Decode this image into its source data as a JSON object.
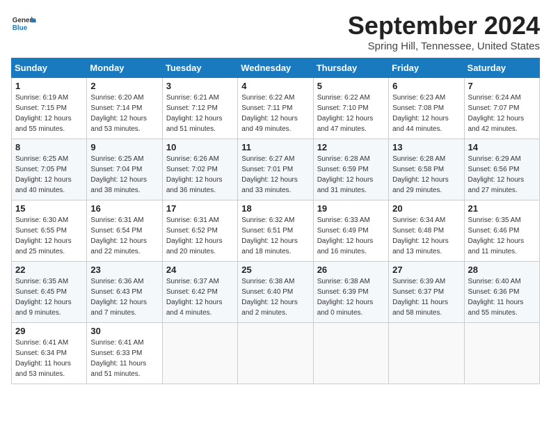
{
  "header": {
    "logo_general": "General",
    "logo_blue": "Blue",
    "title": "September 2024",
    "subtitle": "Spring Hill, Tennessee, United States"
  },
  "weekdays": [
    "Sunday",
    "Monday",
    "Tuesday",
    "Wednesday",
    "Thursday",
    "Friday",
    "Saturday"
  ],
  "weeks": [
    [
      {
        "day": "1",
        "sunrise": "6:19 AM",
        "sunset": "7:15 PM",
        "daylight": "12 hours and 55 minutes."
      },
      {
        "day": "2",
        "sunrise": "6:20 AM",
        "sunset": "7:14 PM",
        "daylight": "12 hours and 53 minutes."
      },
      {
        "day": "3",
        "sunrise": "6:21 AM",
        "sunset": "7:12 PM",
        "daylight": "12 hours and 51 minutes."
      },
      {
        "day": "4",
        "sunrise": "6:22 AM",
        "sunset": "7:11 PM",
        "daylight": "12 hours and 49 minutes."
      },
      {
        "day": "5",
        "sunrise": "6:22 AM",
        "sunset": "7:10 PM",
        "daylight": "12 hours and 47 minutes."
      },
      {
        "day": "6",
        "sunrise": "6:23 AM",
        "sunset": "7:08 PM",
        "daylight": "12 hours and 44 minutes."
      },
      {
        "day": "7",
        "sunrise": "6:24 AM",
        "sunset": "7:07 PM",
        "daylight": "12 hours and 42 minutes."
      }
    ],
    [
      {
        "day": "8",
        "sunrise": "6:25 AM",
        "sunset": "7:05 PM",
        "daylight": "12 hours and 40 minutes."
      },
      {
        "day": "9",
        "sunrise": "6:25 AM",
        "sunset": "7:04 PM",
        "daylight": "12 hours and 38 minutes."
      },
      {
        "day": "10",
        "sunrise": "6:26 AM",
        "sunset": "7:02 PM",
        "daylight": "12 hours and 36 minutes."
      },
      {
        "day": "11",
        "sunrise": "6:27 AM",
        "sunset": "7:01 PM",
        "daylight": "12 hours and 33 minutes."
      },
      {
        "day": "12",
        "sunrise": "6:28 AM",
        "sunset": "6:59 PM",
        "daylight": "12 hours and 31 minutes."
      },
      {
        "day": "13",
        "sunrise": "6:28 AM",
        "sunset": "6:58 PM",
        "daylight": "12 hours and 29 minutes."
      },
      {
        "day": "14",
        "sunrise": "6:29 AM",
        "sunset": "6:56 PM",
        "daylight": "12 hours and 27 minutes."
      }
    ],
    [
      {
        "day": "15",
        "sunrise": "6:30 AM",
        "sunset": "6:55 PM",
        "daylight": "12 hours and 25 minutes."
      },
      {
        "day": "16",
        "sunrise": "6:31 AM",
        "sunset": "6:54 PM",
        "daylight": "12 hours and 22 minutes."
      },
      {
        "day": "17",
        "sunrise": "6:31 AM",
        "sunset": "6:52 PM",
        "daylight": "12 hours and 20 minutes."
      },
      {
        "day": "18",
        "sunrise": "6:32 AM",
        "sunset": "6:51 PM",
        "daylight": "12 hours and 18 minutes."
      },
      {
        "day": "19",
        "sunrise": "6:33 AM",
        "sunset": "6:49 PM",
        "daylight": "12 hours and 16 minutes."
      },
      {
        "day": "20",
        "sunrise": "6:34 AM",
        "sunset": "6:48 PM",
        "daylight": "12 hours and 13 minutes."
      },
      {
        "day": "21",
        "sunrise": "6:35 AM",
        "sunset": "6:46 PM",
        "daylight": "12 hours and 11 minutes."
      }
    ],
    [
      {
        "day": "22",
        "sunrise": "6:35 AM",
        "sunset": "6:45 PM",
        "daylight": "12 hours and 9 minutes."
      },
      {
        "day": "23",
        "sunrise": "6:36 AM",
        "sunset": "6:43 PM",
        "daylight": "12 hours and 7 minutes."
      },
      {
        "day": "24",
        "sunrise": "6:37 AM",
        "sunset": "6:42 PM",
        "daylight": "12 hours and 4 minutes."
      },
      {
        "day": "25",
        "sunrise": "6:38 AM",
        "sunset": "6:40 PM",
        "daylight": "12 hours and 2 minutes."
      },
      {
        "day": "26",
        "sunrise": "6:38 AM",
        "sunset": "6:39 PM",
        "daylight": "12 hours and 0 minutes."
      },
      {
        "day": "27",
        "sunrise": "6:39 AM",
        "sunset": "6:37 PM",
        "daylight": "11 hours and 58 minutes."
      },
      {
        "day": "28",
        "sunrise": "6:40 AM",
        "sunset": "6:36 PM",
        "daylight": "11 hours and 55 minutes."
      }
    ],
    [
      {
        "day": "29",
        "sunrise": "6:41 AM",
        "sunset": "6:34 PM",
        "daylight": "11 hours and 53 minutes."
      },
      {
        "day": "30",
        "sunrise": "6:41 AM",
        "sunset": "6:33 PM",
        "daylight": "11 hours and 51 minutes."
      },
      null,
      null,
      null,
      null,
      null
    ]
  ]
}
